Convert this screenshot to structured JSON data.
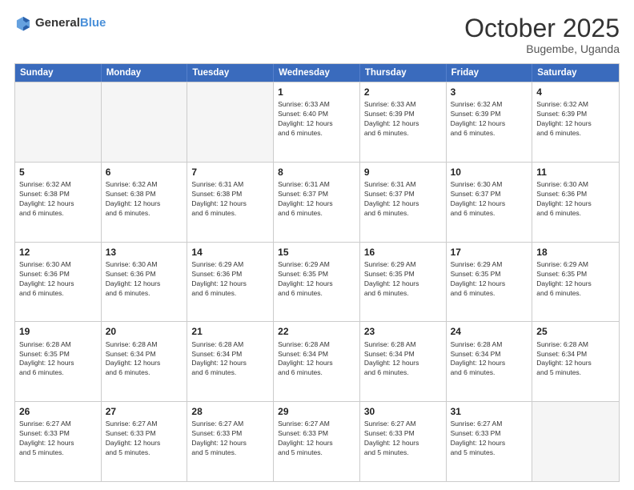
{
  "header": {
    "logo_general": "General",
    "logo_blue": "Blue",
    "month": "October 2025",
    "location": "Bugembe, Uganda"
  },
  "weekdays": [
    "Sunday",
    "Monday",
    "Tuesday",
    "Wednesday",
    "Thursday",
    "Friday",
    "Saturday"
  ],
  "weeks": [
    [
      {
        "day": "",
        "info": ""
      },
      {
        "day": "",
        "info": ""
      },
      {
        "day": "",
        "info": ""
      },
      {
        "day": "1",
        "info": "Sunrise: 6:33 AM\nSunset: 6:40 PM\nDaylight: 12 hours\nand 6 minutes."
      },
      {
        "day": "2",
        "info": "Sunrise: 6:33 AM\nSunset: 6:39 PM\nDaylight: 12 hours\nand 6 minutes."
      },
      {
        "day": "3",
        "info": "Sunrise: 6:32 AM\nSunset: 6:39 PM\nDaylight: 12 hours\nand 6 minutes."
      },
      {
        "day": "4",
        "info": "Sunrise: 6:32 AM\nSunset: 6:39 PM\nDaylight: 12 hours\nand 6 minutes."
      }
    ],
    [
      {
        "day": "5",
        "info": "Sunrise: 6:32 AM\nSunset: 6:38 PM\nDaylight: 12 hours\nand 6 minutes."
      },
      {
        "day": "6",
        "info": "Sunrise: 6:32 AM\nSunset: 6:38 PM\nDaylight: 12 hours\nand 6 minutes."
      },
      {
        "day": "7",
        "info": "Sunrise: 6:31 AM\nSunset: 6:38 PM\nDaylight: 12 hours\nand 6 minutes."
      },
      {
        "day": "8",
        "info": "Sunrise: 6:31 AM\nSunset: 6:37 PM\nDaylight: 12 hours\nand 6 minutes."
      },
      {
        "day": "9",
        "info": "Sunrise: 6:31 AM\nSunset: 6:37 PM\nDaylight: 12 hours\nand 6 minutes."
      },
      {
        "day": "10",
        "info": "Sunrise: 6:30 AM\nSunset: 6:37 PM\nDaylight: 12 hours\nand 6 minutes."
      },
      {
        "day": "11",
        "info": "Sunrise: 6:30 AM\nSunset: 6:36 PM\nDaylight: 12 hours\nand 6 minutes."
      }
    ],
    [
      {
        "day": "12",
        "info": "Sunrise: 6:30 AM\nSunset: 6:36 PM\nDaylight: 12 hours\nand 6 minutes."
      },
      {
        "day": "13",
        "info": "Sunrise: 6:30 AM\nSunset: 6:36 PM\nDaylight: 12 hours\nand 6 minutes."
      },
      {
        "day": "14",
        "info": "Sunrise: 6:29 AM\nSunset: 6:36 PM\nDaylight: 12 hours\nand 6 minutes."
      },
      {
        "day": "15",
        "info": "Sunrise: 6:29 AM\nSunset: 6:35 PM\nDaylight: 12 hours\nand 6 minutes."
      },
      {
        "day": "16",
        "info": "Sunrise: 6:29 AM\nSunset: 6:35 PM\nDaylight: 12 hours\nand 6 minutes."
      },
      {
        "day": "17",
        "info": "Sunrise: 6:29 AM\nSunset: 6:35 PM\nDaylight: 12 hours\nand 6 minutes."
      },
      {
        "day": "18",
        "info": "Sunrise: 6:29 AM\nSunset: 6:35 PM\nDaylight: 12 hours\nand 6 minutes."
      }
    ],
    [
      {
        "day": "19",
        "info": "Sunrise: 6:28 AM\nSunset: 6:35 PM\nDaylight: 12 hours\nand 6 minutes."
      },
      {
        "day": "20",
        "info": "Sunrise: 6:28 AM\nSunset: 6:34 PM\nDaylight: 12 hours\nand 6 minutes."
      },
      {
        "day": "21",
        "info": "Sunrise: 6:28 AM\nSunset: 6:34 PM\nDaylight: 12 hours\nand 6 minutes."
      },
      {
        "day": "22",
        "info": "Sunrise: 6:28 AM\nSunset: 6:34 PM\nDaylight: 12 hours\nand 6 minutes."
      },
      {
        "day": "23",
        "info": "Sunrise: 6:28 AM\nSunset: 6:34 PM\nDaylight: 12 hours\nand 6 minutes."
      },
      {
        "day": "24",
        "info": "Sunrise: 6:28 AM\nSunset: 6:34 PM\nDaylight: 12 hours\nand 6 minutes."
      },
      {
        "day": "25",
        "info": "Sunrise: 6:28 AM\nSunset: 6:34 PM\nDaylight: 12 hours\nand 5 minutes."
      }
    ],
    [
      {
        "day": "26",
        "info": "Sunrise: 6:27 AM\nSunset: 6:33 PM\nDaylight: 12 hours\nand 5 minutes."
      },
      {
        "day": "27",
        "info": "Sunrise: 6:27 AM\nSunset: 6:33 PM\nDaylight: 12 hours\nand 5 minutes."
      },
      {
        "day": "28",
        "info": "Sunrise: 6:27 AM\nSunset: 6:33 PM\nDaylight: 12 hours\nand 5 minutes."
      },
      {
        "day": "29",
        "info": "Sunrise: 6:27 AM\nSunset: 6:33 PM\nDaylight: 12 hours\nand 5 minutes."
      },
      {
        "day": "30",
        "info": "Sunrise: 6:27 AM\nSunset: 6:33 PM\nDaylight: 12 hours\nand 5 minutes."
      },
      {
        "day": "31",
        "info": "Sunrise: 6:27 AM\nSunset: 6:33 PM\nDaylight: 12 hours\nand 5 minutes."
      },
      {
        "day": "",
        "info": ""
      }
    ]
  ]
}
